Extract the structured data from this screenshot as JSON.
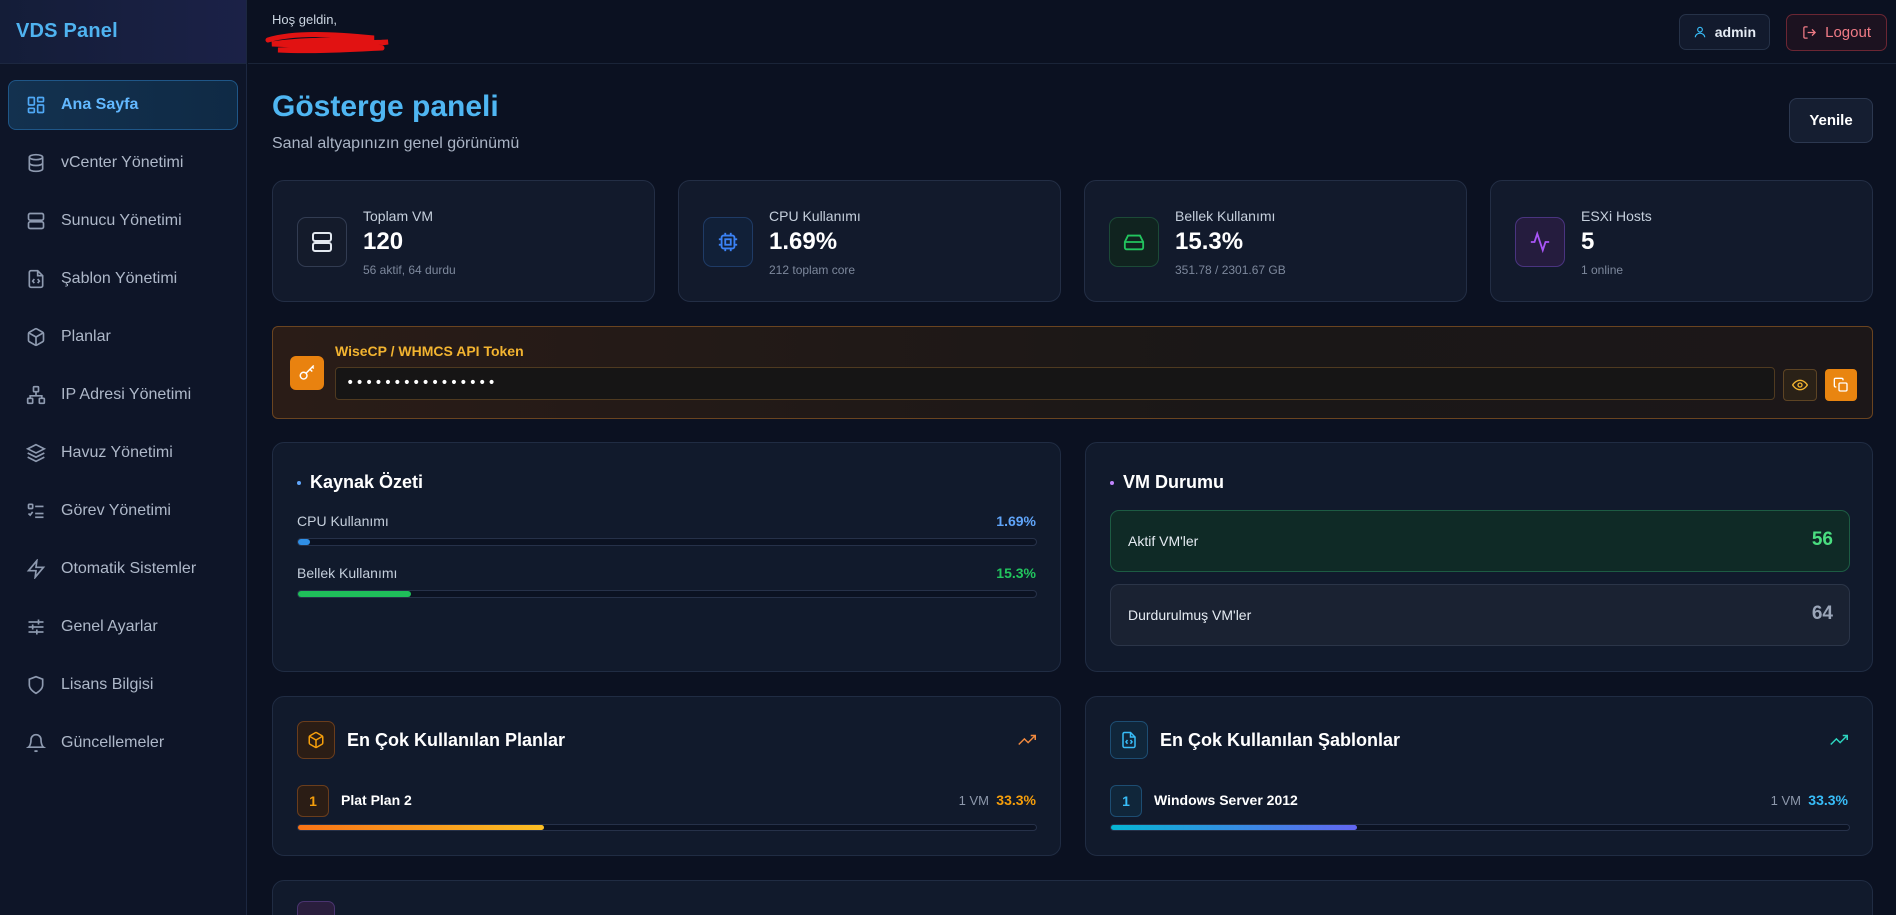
{
  "brand": "VDS Panel",
  "sidebar": {
    "items": [
      {
        "label": "Ana Sayfa",
        "icon": "dashboard-grid-icon",
        "active": true
      },
      {
        "label": "vCenter Yönetimi",
        "icon": "database-icon"
      },
      {
        "label": "Sunucu Yönetimi",
        "icon": "server-icon"
      },
      {
        "label": "Şablon Yönetimi",
        "icon": "file-code-icon"
      },
      {
        "label": "Planlar",
        "icon": "package-icon"
      },
      {
        "label": "IP Adresi Yönetimi",
        "icon": "network-icon"
      },
      {
        "label": "Havuz Yönetimi",
        "icon": "layers-icon"
      },
      {
        "label": "Görev Yönetimi",
        "icon": "task-list-icon"
      },
      {
        "label": "Otomatik Sistemler",
        "icon": "lightning-icon"
      },
      {
        "label": "Genel Ayarlar",
        "icon": "sliders-icon"
      },
      {
        "label": "Lisans Bilgisi",
        "icon": "shield-icon"
      },
      {
        "label": "Güncellemeler",
        "icon": "bell-icon"
      }
    ]
  },
  "topbar": {
    "greeting": "Hoş geldin,",
    "user_label": "admin",
    "logout_label": "Logout"
  },
  "header": {
    "title": "Gösterge paneli",
    "subtitle": "Sanal altyapınızın genel görünümü",
    "refresh_label": "Yenile"
  },
  "stats": [
    {
      "label": "Toplam VM",
      "value": "120",
      "sub": "56 aktif, 64 durdu",
      "icon": "server-icon",
      "accent": "#cbd5e1"
    },
    {
      "label": "CPU Kullanımı",
      "value": "1.69%",
      "sub": "212 toplam core",
      "icon": "cpu-icon",
      "accent": "#3b82f6"
    },
    {
      "label": "Bellek Kullanımı",
      "value": "15.3%",
      "sub": "351.78 / 2301.67 GB",
      "icon": "hard-drive-icon",
      "accent": "#22c55e"
    },
    {
      "label": "ESXi Hosts",
      "value": "5",
      "sub": "1 online",
      "icon": "activity-icon",
      "accent": "#a855f7"
    }
  ],
  "api_token": {
    "label": "WiseCP / WHMCS API Token",
    "value": "••••••••••••••••"
  },
  "resource_summary": {
    "title": "Kaynak Özeti",
    "items": [
      {
        "label": "CPU Kullanımı",
        "percent_text": "1.69%",
        "percent": 1.69,
        "color": "#60a5fa"
      },
      {
        "label": "Bellek Kullanımı",
        "percent_text": "15.3%",
        "percent": 15.3,
        "color": "#22c55e"
      }
    ]
  },
  "vm_status": {
    "title": "VM Durumu",
    "active_label": "Aktif VM'ler",
    "active_count": "56",
    "stopped_label": "Durdurulmuş VM'ler",
    "stopped_count": "64"
  },
  "top_plans": {
    "title": "En Çok Kullanılan Planlar",
    "items": [
      {
        "rank": "1",
        "name": "Plat Plan 2",
        "count": "1 VM",
        "percent_text": "33.3%",
        "percent": 33.3
      }
    ]
  },
  "top_templates": {
    "title": "En Çok Kullanılan Şablonlar",
    "items": [
      {
        "rank": "1",
        "name": "Windows Server 2012",
        "count": "1 VM",
        "percent_text": "33.3%",
        "percent": 33.3
      }
    ]
  }
}
